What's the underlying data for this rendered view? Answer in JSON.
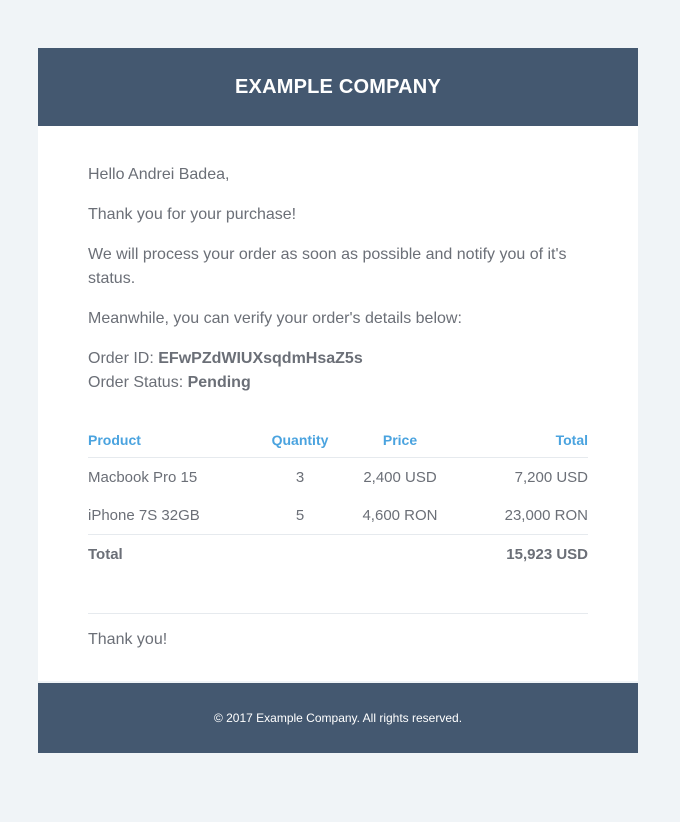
{
  "header": {
    "company": "EXAMPLE COMPANY"
  },
  "body": {
    "greeting": "Hello Andrei Badea,",
    "thanks": "Thank you for your purchase!",
    "process": "We will process your order as soon as possible and notify you of it's status.",
    "meanwhile": "Meanwhile, you can verify your order's details below:",
    "order_id_label": "Order ID:",
    "order_id": "EFwPZdWIUXsqdmHsaZ5s",
    "order_status_label": "Order Status:",
    "order_status": "Pending",
    "signoff": "Thank you!"
  },
  "table": {
    "headers": {
      "product": "Product",
      "quantity": "Quantity",
      "price": "Price",
      "total": "Total"
    },
    "rows": [
      {
        "product": "Macbook Pro 15",
        "quantity": "3",
        "price": "2,400 USD",
        "total": "7,200 USD"
      },
      {
        "product": "iPhone 7S 32GB",
        "quantity": "5",
        "price": "4,600 RON",
        "total": "23,000 RON"
      }
    ],
    "total_label": "Total",
    "total_value": "15,923 USD"
  },
  "footer": {
    "copyright": "© 2017 Example Company. All rights reserved."
  },
  "colors": {
    "header_bg": "#445870",
    "accent": "#4aa3df",
    "text": "#6b6f77",
    "page_bg": "#f0f4f7"
  }
}
